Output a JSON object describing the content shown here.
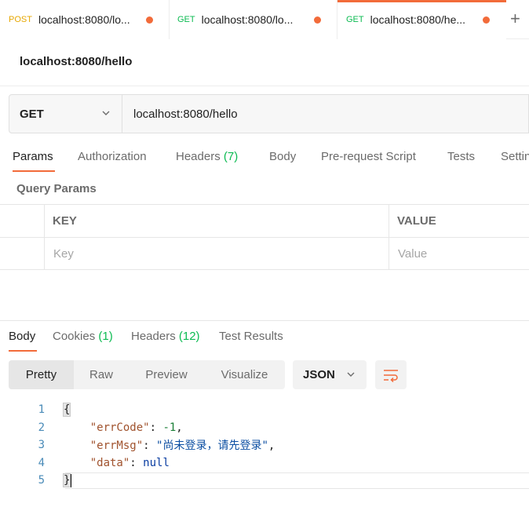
{
  "tabs": [
    {
      "method": "POST",
      "method_color": "#e6a700",
      "title": "localhost:8080/lo..."
    },
    {
      "method": "GET",
      "method_color": "#0cbb52",
      "title": "localhost:8080/lo..."
    },
    {
      "method": "GET",
      "method_color": "#0cbb52",
      "title": "localhost:8080/he..."
    }
  ],
  "new_tab_label": "+",
  "request": {
    "name": "localhost:8080/hello",
    "method": "GET",
    "url": "localhost:8080/hello"
  },
  "request_tabs": {
    "params": "Params",
    "authorization": "Authorization",
    "headers": "Headers",
    "headers_count": "(7)",
    "body": "Body",
    "prerequest": "Pre-request Script",
    "tests": "Tests",
    "settings": "Settin"
  },
  "query_params": {
    "label": "Query Params",
    "key_header": "KEY",
    "value_header": "VALUE",
    "key_placeholder": "Key",
    "value_placeholder": "Value"
  },
  "response_tabs": {
    "body": "Body",
    "cookies": "Cookies",
    "cookies_count": "(1)",
    "headers": "Headers",
    "headers_count": "(12)",
    "test_results": "Test Results"
  },
  "view_modes": {
    "pretty": "Pretty",
    "raw": "Raw",
    "preview": "Preview",
    "visualize": "Visualize"
  },
  "format": "JSON",
  "code_lines": {
    "n1": "1",
    "n2": "2",
    "n3": "3",
    "n4": "4",
    "n5": "5",
    "open": "{",
    "close": "}",
    "k1": "\"errCode\"",
    "v1": "-1",
    "k2": "\"errMsg\"",
    "v2": "\"尚未登录，请先登录\"",
    "k3": "\"data\"",
    "v3": "null"
  },
  "colors": {
    "accent": "#f26b3a",
    "count_green": "#0cbb52"
  }
}
